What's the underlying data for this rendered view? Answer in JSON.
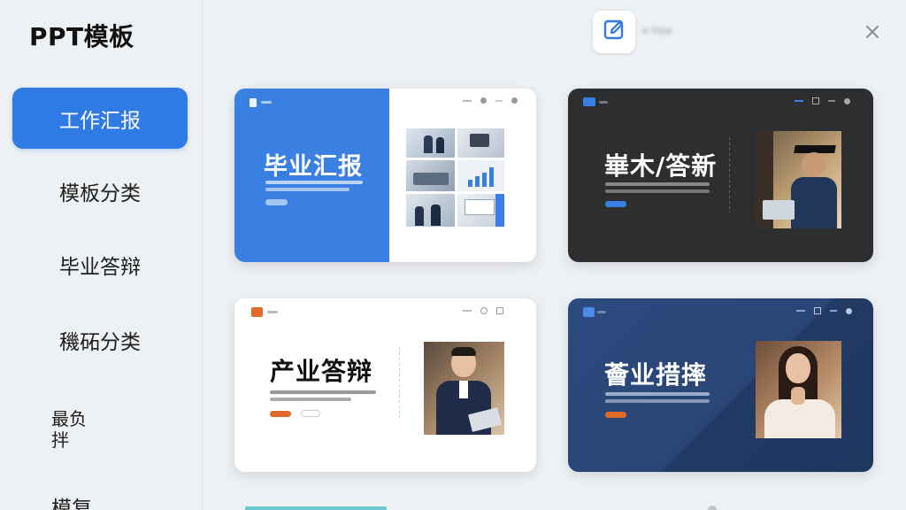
{
  "sidebar": {
    "title": "PPT模板",
    "items": [
      {
        "label": "工作汇报",
        "active": true
      },
      {
        "label": "模板分类",
        "active": false
      },
      {
        "label": "毕业答辩",
        "active": false
      },
      {
        "label": "穖砳分类",
        "active": false
      },
      {
        "label": "最负\n拌",
        "active": false
      },
      {
        "label": "模复",
        "active": false
      }
    ]
  },
  "topbar": {
    "edit_icon": "edit-icon",
    "label": "e lilaa",
    "close_icon": "close-icon"
  },
  "cards": [
    {
      "title": "毕业汇报",
      "theme": "blue-white",
      "accent": "#3a80e3"
    },
    {
      "title": "崋木/答新",
      "theme": "dark",
      "accent": "#2d2e30"
    },
    {
      "title": "产业答辩",
      "theme": "white",
      "accent": "#e06a2a"
    },
    {
      "title": "薈业措摔",
      "theme": "navy",
      "accent": "#2b4a7e"
    }
  ],
  "colors": {
    "primary": "#2f7ae5",
    "background": "#eef1f4",
    "orange": "#e06a2a"
  }
}
